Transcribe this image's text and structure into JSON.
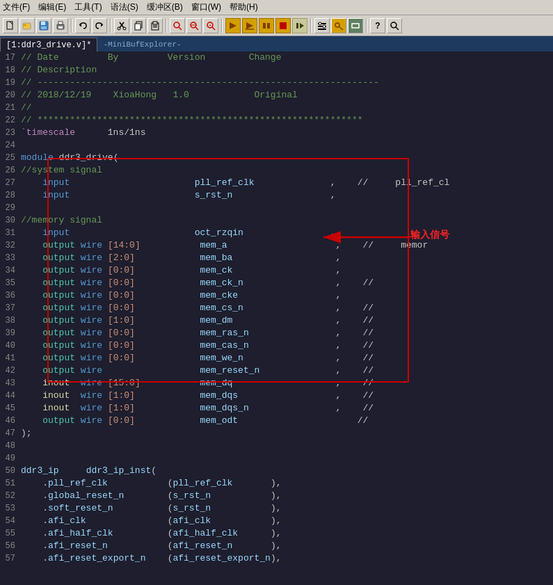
{
  "menubar": {
    "items": [
      "文件(F)",
      "编辑(E)",
      "工具(T)",
      "语法(S)",
      "缓冲区(B)",
      "窗口(W)",
      "帮助(H)"
    ]
  },
  "toolbar": {
    "buttons": [
      "📄",
      "💾",
      "🖨",
      "📋",
      "↩",
      "↪",
      "✂",
      "📋",
      "📋",
      "🔍",
      "🔍",
      "🔍",
      "⚡",
      "⚡",
      "⚡",
      "⚡",
      "⚡",
      "⚡",
      "🔨",
      "🔑",
      "▬",
      "?",
      "🔍"
    ]
  },
  "tabs": {
    "active": "[1:ddr3_drive.v]*",
    "minibuf": "-MiniBufExplorer-"
  },
  "code": {
    "lines": [
      {
        "num": "17",
        "content": "// Date         By         Version        Change"
      },
      {
        "num": "18",
        "content": "// Description"
      },
      {
        "num": "19",
        "content": "// ---------------------------------------------------------------"
      },
      {
        "num": "20",
        "content": "// 2018/12/19    XioaHong   1.0            Original"
      },
      {
        "num": "21",
        "content": "//"
      },
      {
        "num": "22",
        "content": "// ************************************************************"
      },
      {
        "num": "23",
        "content": "`timescale      1ns/1ns"
      },
      {
        "num": "24",
        "content": ""
      },
      {
        "num": "25",
        "content": "module ddr3_drive("
      },
      {
        "num": "26",
        "content": "//system signal"
      },
      {
        "num": "27",
        "content": "    input                       pll_ref_clk              ,    //     pll_ref_cl"
      },
      {
        "num": "28",
        "content": "    input                       s_rst_n                  ,"
      },
      {
        "num": "29",
        "content": ""
      },
      {
        "num": "30",
        "content": "//memory signal"
      },
      {
        "num": "31",
        "content": "    input                       oct_rzqin                ,"
      },
      {
        "num": "32",
        "content": "    output wire [14:0]           mem_a                    ,    //     memor"
      },
      {
        "num": "33",
        "content": "    output wire [2:0]            mem_ba                   ,"
      },
      {
        "num": "34",
        "content": "    output wire [0:0]            mem_ck                   ,"
      },
      {
        "num": "35",
        "content": "    output wire [0:0]            mem_ck_n                 ,    //"
      },
      {
        "num": "36",
        "content": "    output wire [0:0]            mem_cke                  ,"
      },
      {
        "num": "37",
        "content": "    output wire [0:0]            mem_cs_n                 ,    //"
      },
      {
        "num": "38",
        "content": "    output wire [1:0]            mem_dm                   ,    //"
      },
      {
        "num": "39",
        "content": "    output wire [0:0]            mem_ras_n                ,    //"
      },
      {
        "num": "40",
        "content": "    output wire [0:0]            mem_cas_n                ,    //"
      },
      {
        "num": "41",
        "content": "    output wire [0:0]            mem_we_n                 ,    //"
      },
      {
        "num": "42",
        "content": "    output wire                  mem_reset_n              ,    //"
      },
      {
        "num": "43",
        "content": "    inout  wire [15:0]           mem_dq                   ,    //"
      },
      {
        "num": "44",
        "content": "    inout  wire [1:0]            mem_dqs                  ,    //"
      },
      {
        "num": "45",
        "content": "    inout  wire [1:0]            mem_dqs_n                ,    //"
      },
      {
        "num": "46",
        "content": "    output wire [0:0]            mem_odt                      //"
      },
      {
        "num": "47",
        "content": ");"
      },
      {
        "num": "48",
        "content": ""
      },
      {
        "num": "49",
        "content": ""
      },
      {
        "num": "50",
        "content": "ddr3_ip     ddr3_ip_inst("
      },
      {
        "num": "51",
        "content": "    .pll_ref_clk           (pll_ref_clk       ),"
      },
      {
        "num": "52",
        "content": "    .global_reset_n        (s_rst_n           ),"
      },
      {
        "num": "53",
        "content": "    .soft_reset_n          (s_rst_n           ),"
      },
      {
        "num": "54",
        "content": "    .afi_clk               (afi_clk           ),"
      },
      {
        "num": "55",
        "content": "    .afi_half_clk          (afi_half_clk      ),"
      },
      {
        "num": "56",
        "content": "    .afi_reset_n           (afi_reset_n       ),"
      },
      {
        "num": "57",
        "content": "    .afi_reset_export_n    (afi_reset_export_n),"
      }
    ]
  },
  "annotation": {
    "label": "输入信号",
    "arrow_text": "←"
  }
}
